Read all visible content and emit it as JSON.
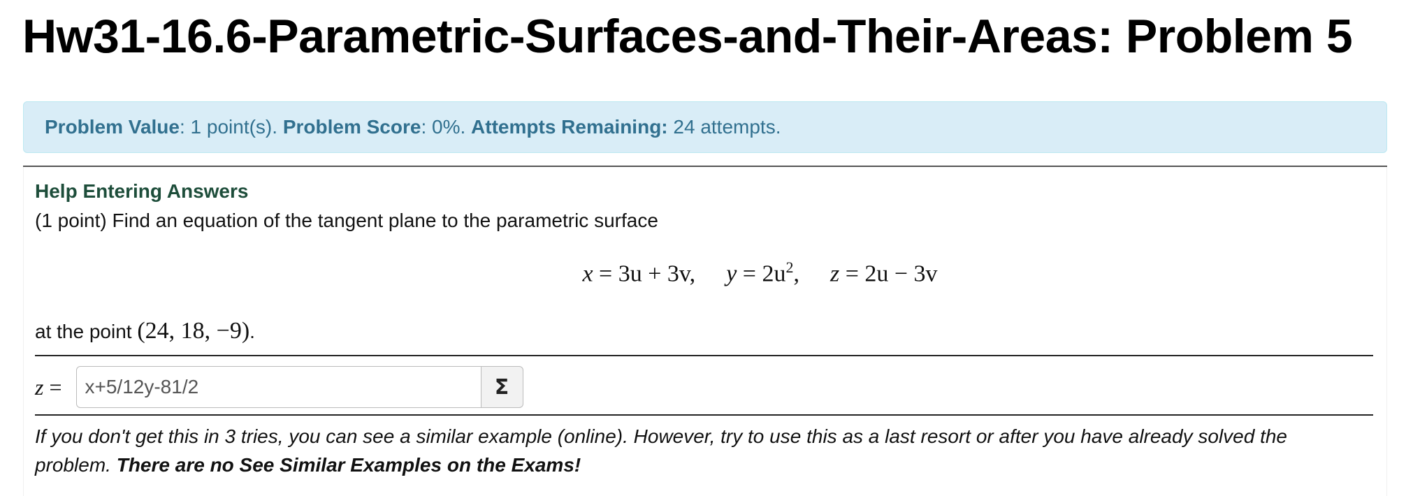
{
  "page_title": "Hw31-16.6-Parametric-Surfaces-and-Their-Areas: Problem 5",
  "status": {
    "value_label": "Problem Value",
    "value_text": ": 1 point(s). ",
    "score_label": "Problem Score",
    "score_text": ": 0%. ",
    "attempts_label": "Attempts Remaining:",
    "attempts_text": " 24 attempts."
  },
  "help_link": "Help Entering Answers",
  "prompt": "(1 point) Find an equation of the tangent plane to the parametric surface",
  "equation": {
    "x_lhs": "x",
    "x_rhs": " = 3u + 3v,",
    "y_lhs": "y",
    "y_rhs_base": " = 2u",
    "y_rhs_exp": "2",
    "y_rhs_tail": ",",
    "z_lhs": "z",
    "z_rhs": " = 2u − 3v"
  },
  "point_line": {
    "prefix": "at the point ",
    "point": "(24, 18, −9)",
    "suffix": "."
  },
  "answer": {
    "label_var": "z",
    "label_eq": " =",
    "value": "x+5/12y-81/2",
    "equation_editor_symbol": "Σ"
  },
  "hint": {
    "italic_text": "If you don't get this in 3 tries, you can see a similar example (online). However, try to use this as a last resort or after you have already solved the problem. ",
    "bold_text": "There are no See Similar Examples on the Exams!"
  },
  "colors": {
    "alert_bg": "#d9edf7",
    "alert_text": "#31708f",
    "help_link": "#1d4d3a"
  },
  "icons": {
    "equation_editor": "sigma-icon"
  }
}
